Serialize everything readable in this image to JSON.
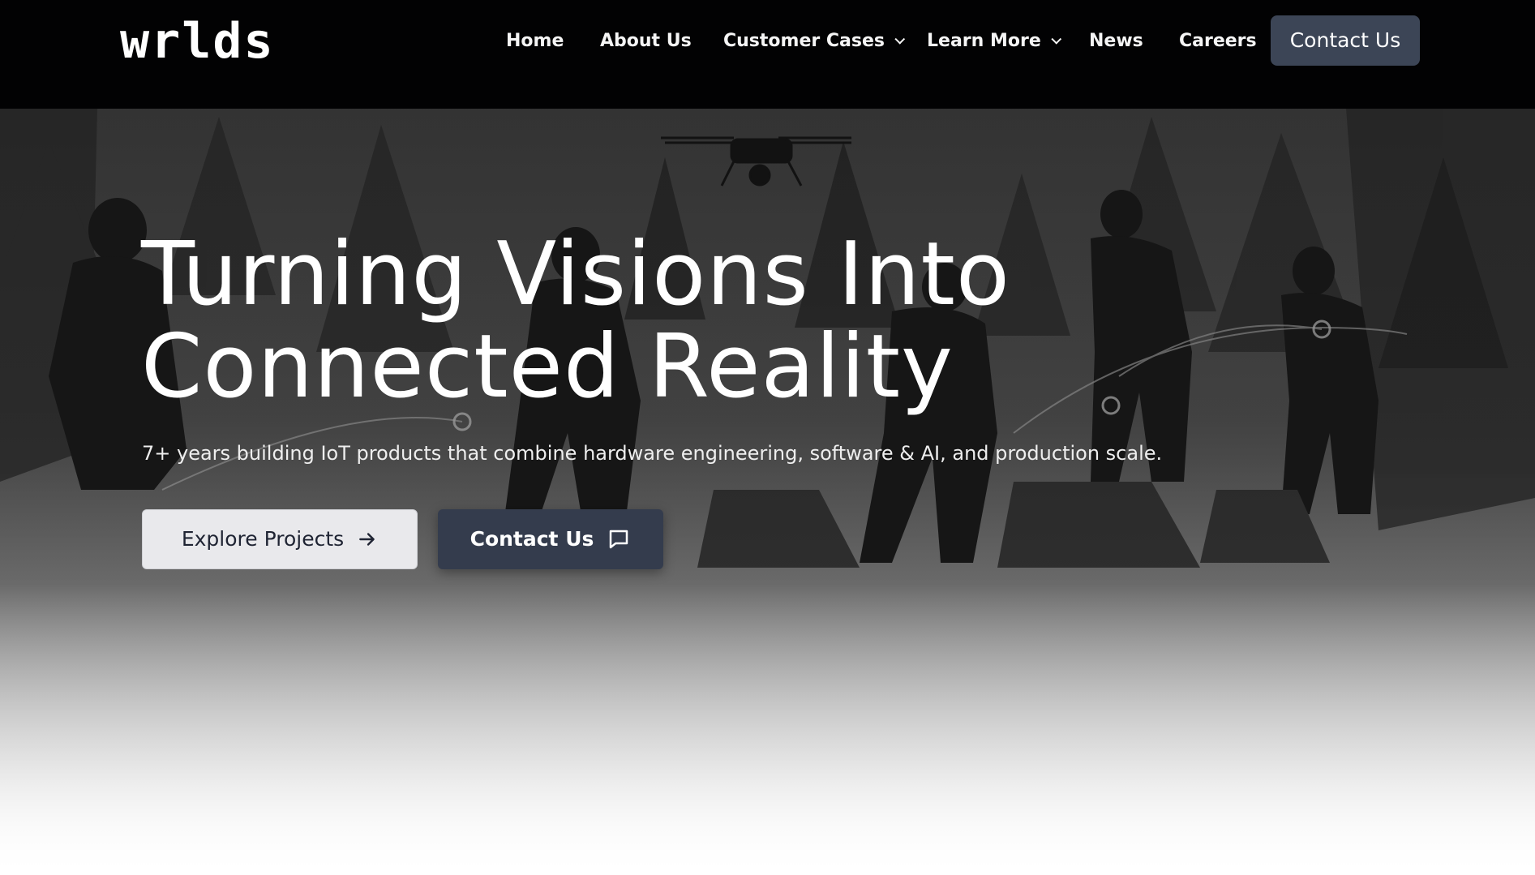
{
  "brand": {
    "logo_text": "wrlds"
  },
  "nav": {
    "items": [
      {
        "label": "Home"
      },
      {
        "label": "About Us"
      },
      {
        "label": "Customer Cases"
      },
      {
        "label": "Learn More"
      },
      {
        "label": "News"
      },
      {
        "label": "Careers"
      }
    ],
    "cta_label": "Contact Us"
  },
  "hero": {
    "headline_line1": "Turning Visions Into",
    "headline_line2": "Connected Reality",
    "subtitle": "7+ years building IoT products that combine hardware engineering, software & AI, and production scale.",
    "primary_button_label": "Explore Projects",
    "primary_button_icon": "arrow-right-icon",
    "secondary_button_label": "Contact Us",
    "secondary_button_icon": "chat-bubble-icon",
    "background_description_icon": "drone-icon"
  },
  "colors": {
    "nav_background": "#020203",
    "cta_background": "#3c4556",
    "primary_button_background": "#e9e9ec",
    "secondary_button_background": "#343c4d"
  }
}
